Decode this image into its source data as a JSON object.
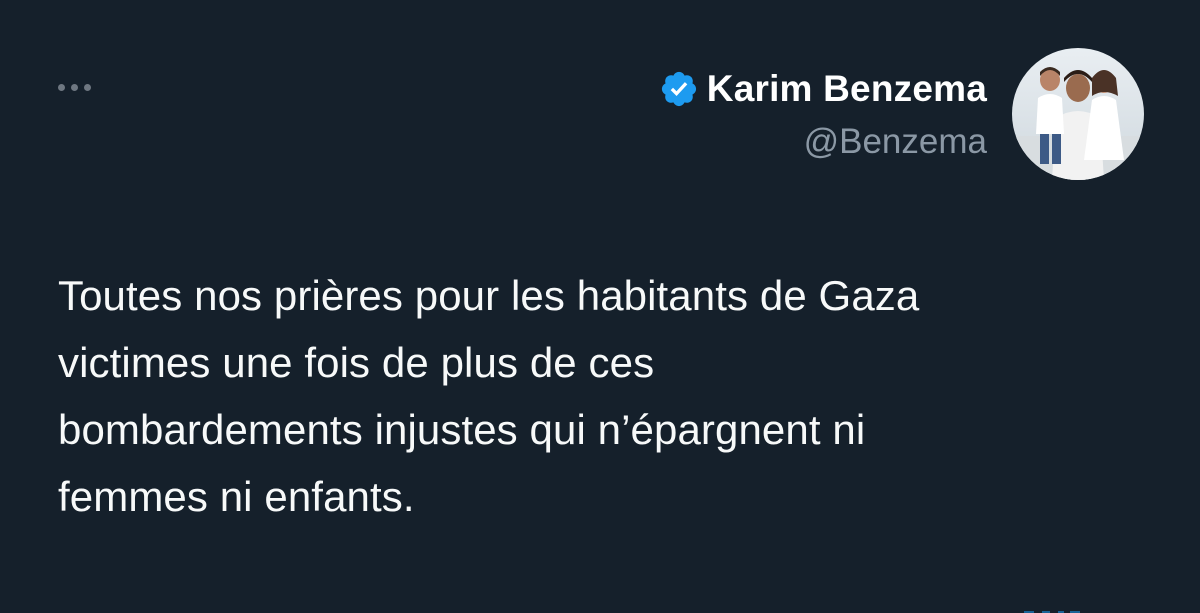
{
  "author": {
    "display_name": "Karim Benzema",
    "handle": "@Benzema",
    "verified": true,
    "verified_icon": "verified-badge-icon",
    "avatar": "profile-photo"
  },
  "more_icon": "more-horizontal-icon",
  "tweet": {
    "lines": [
      "Toutes nos prières pour les habitants de Gaza",
      "victimes une fois de plus de ces",
      "bombardements injustes qui n’épargnent ni",
      "femmes ni enfants."
    ]
  },
  "colors": {
    "background": "#15202b",
    "text": "#f7f9f9",
    "secondary_text": "#8b98a5",
    "verified_blue": "#1d9bf0"
  }
}
